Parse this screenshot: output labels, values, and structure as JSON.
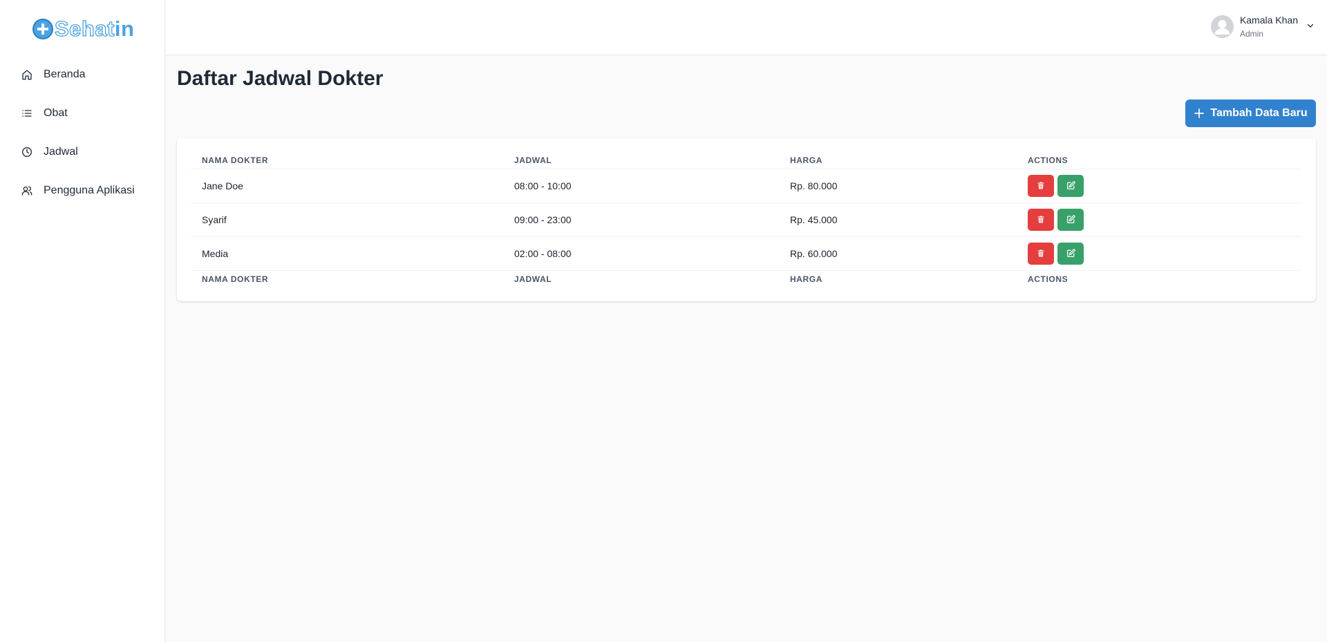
{
  "brand": {
    "logo_text_a": "Sehat",
    "logo_text_b": "in",
    "accent": "#4aa3df"
  },
  "sidebar": {
    "items": [
      {
        "label": "Beranda",
        "icon": "home-icon"
      },
      {
        "label": "Obat",
        "icon": "list-icon"
      },
      {
        "label": "Jadwal",
        "icon": "clock-icon"
      },
      {
        "label": "Pengguna Aplikasi",
        "icon": "users-icon"
      }
    ]
  },
  "header": {
    "user_name": "Kamala Khan",
    "user_role": "Admin"
  },
  "main": {
    "title": "Daftar Jadwal Dokter",
    "add_button_label": "Tambah Data Baru",
    "add_button_color": "#3182ce"
  },
  "table": {
    "columns": [
      "NAMA DOKTER",
      "JADWAL",
      "HARGA",
      "ACTIONS"
    ],
    "rows": [
      {
        "nama": "Jane Doe",
        "jadwal": "08:00 - 10:00",
        "harga": "Rp. 80.000"
      },
      {
        "nama": "Syarif",
        "jadwal": "09:00 - 23:00",
        "harga": "Rp. 45.000"
      },
      {
        "nama": "Media",
        "jadwal": "02:00 - 08:00",
        "harga": "Rp. 60.000"
      }
    ],
    "delete_color": "#e53e3e",
    "edit_color": "#38a169"
  }
}
